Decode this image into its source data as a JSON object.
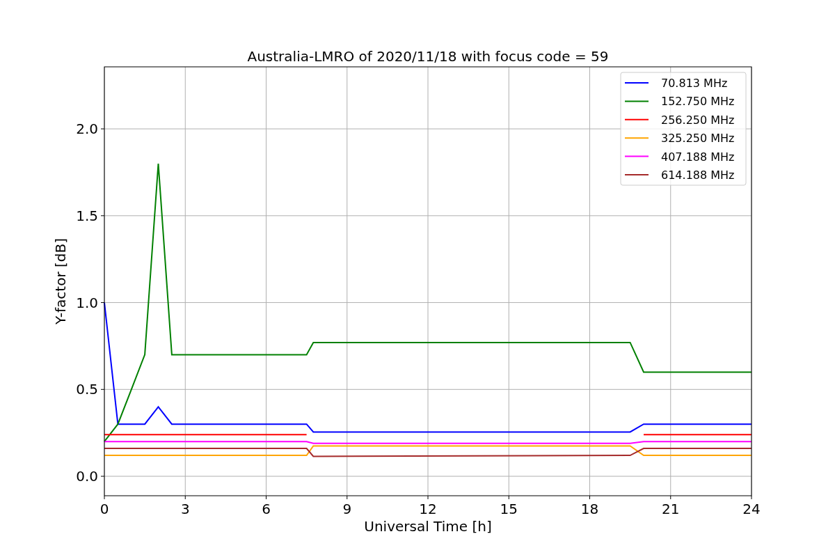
{
  "figure": {
    "chart_data": {
      "type": "line",
      "title": "Australia-LMRO of 2020/11/18 with focus code = 59",
      "xlabel": "Universal Time [h]",
      "ylabel": "Y-factor [dB]",
      "x": [
        0,
        0.5,
        1,
        1.5,
        2,
        2.5,
        3,
        3.5,
        4,
        4.5,
        5,
        5.5,
        6,
        6.5,
        7,
        7.5,
        7.75,
        19.5,
        20,
        20.5,
        21,
        21.5,
        22,
        22.5,
        23,
        23.5,
        24
      ],
      "series": [
        {
          "name": "70.813 MHz",
          "color": "#0000ff",
          "values": [
            1.0,
            0.3,
            0.3,
            0.3,
            0.4,
            0.3,
            0.3,
            0.3,
            0.3,
            0.3,
            0.3,
            0.3,
            0.3,
            0.3,
            0.3,
            0.3,
            0.255,
            0.255,
            0.3,
            0.3,
            0.3,
            0.3,
            0.3,
            0.3,
            0.3,
            0.3,
            0.3
          ]
        },
        {
          "name": "152.750 MHz",
          "color": "#008000",
          "values": [
            0.2,
            0.3,
            0.5,
            0.7,
            1.8,
            0.7,
            0.7,
            0.7,
            0.7,
            0.7,
            0.7,
            0.7,
            0.7,
            0.7,
            0.7,
            0.7,
            0.77,
            0.77,
            0.6,
            0.6,
            0.6,
            0.6,
            0.6,
            0.6,
            0.6,
            0.6,
            0.6
          ]
        },
        {
          "name": "256.250 MHz",
          "color": "#ff0000",
          "values": [
            0.24,
            0.24,
            0.24,
            0.24,
            0.24,
            0.24,
            0.24,
            0.24,
            0.24,
            0.24,
            0.24,
            0.24,
            0.24,
            0.24,
            0.24,
            0.24,
            null,
            null,
            0.24,
            0.24,
            0.24,
            0.24,
            0.24,
            0.24,
            0.24,
            0.24,
            0.24
          ]
        },
        {
          "name": "325.250 MHz",
          "color": "#ffa500",
          "values": [
            0.12,
            0.12,
            0.12,
            0.12,
            0.12,
            0.12,
            0.12,
            0.12,
            0.12,
            0.12,
            0.12,
            0.12,
            0.12,
            0.12,
            0.12,
            0.12,
            0.175,
            0.175,
            0.12,
            0.12,
            0.12,
            0.12,
            0.12,
            0.12,
            0.12,
            0.12,
            0.12
          ]
        },
        {
          "name": "407.188 MHz",
          "color": "#ff00ff",
          "values": [
            0.2,
            0.2,
            0.2,
            0.2,
            0.2,
            0.2,
            0.2,
            0.2,
            0.2,
            0.2,
            0.2,
            0.2,
            0.2,
            0.2,
            0.2,
            0.2,
            0.19,
            0.19,
            0.2,
            0.2,
            0.2,
            0.2,
            0.2,
            0.2,
            0.2,
            0.2,
            0.2
          ]
        },
        {
          "name": "614.188 MHz",
          "color": "#a52a2a",
          "values": [
            0.16,
            0.16,
            0.16,
            0.16,
            0.16,
            0.16,
            0.16,
            0.16,
            0.16,
            0.16,
            0.16,
            0.16,
            0.16,
            0.16,
            0.16,
            0.16,
            0.115,
            0.12,
            0.16,
            0.16,
            0.16,
            0.16,
            0.16,
            0.16,
            0.16,
            0.16,
            0.16
          ]
        }
      ],
      "grid": true,
      "legend": true,
      "xlim": [
        0,
        24
      ],
      "ylim": [
        -0.112,
        2.357
      ],
      "xticks": [
        0,
        3,
        6,
        9,
        12,
        15,
        18,
        21,
        24
      ],
      "yticks": [
        {
          "value": 0,
          "label": "0.0"
        },
        {
          "value": 0.5,
          "label": "0.5"
        },
        {
          "value": 1,
          "label": "1.0"
        },
        {
          "value": 1.5,
          "label": "1.5"
        },
        {
          "value": 2,
          "label": "2.0"
        }
      ]
    }
  }
}
